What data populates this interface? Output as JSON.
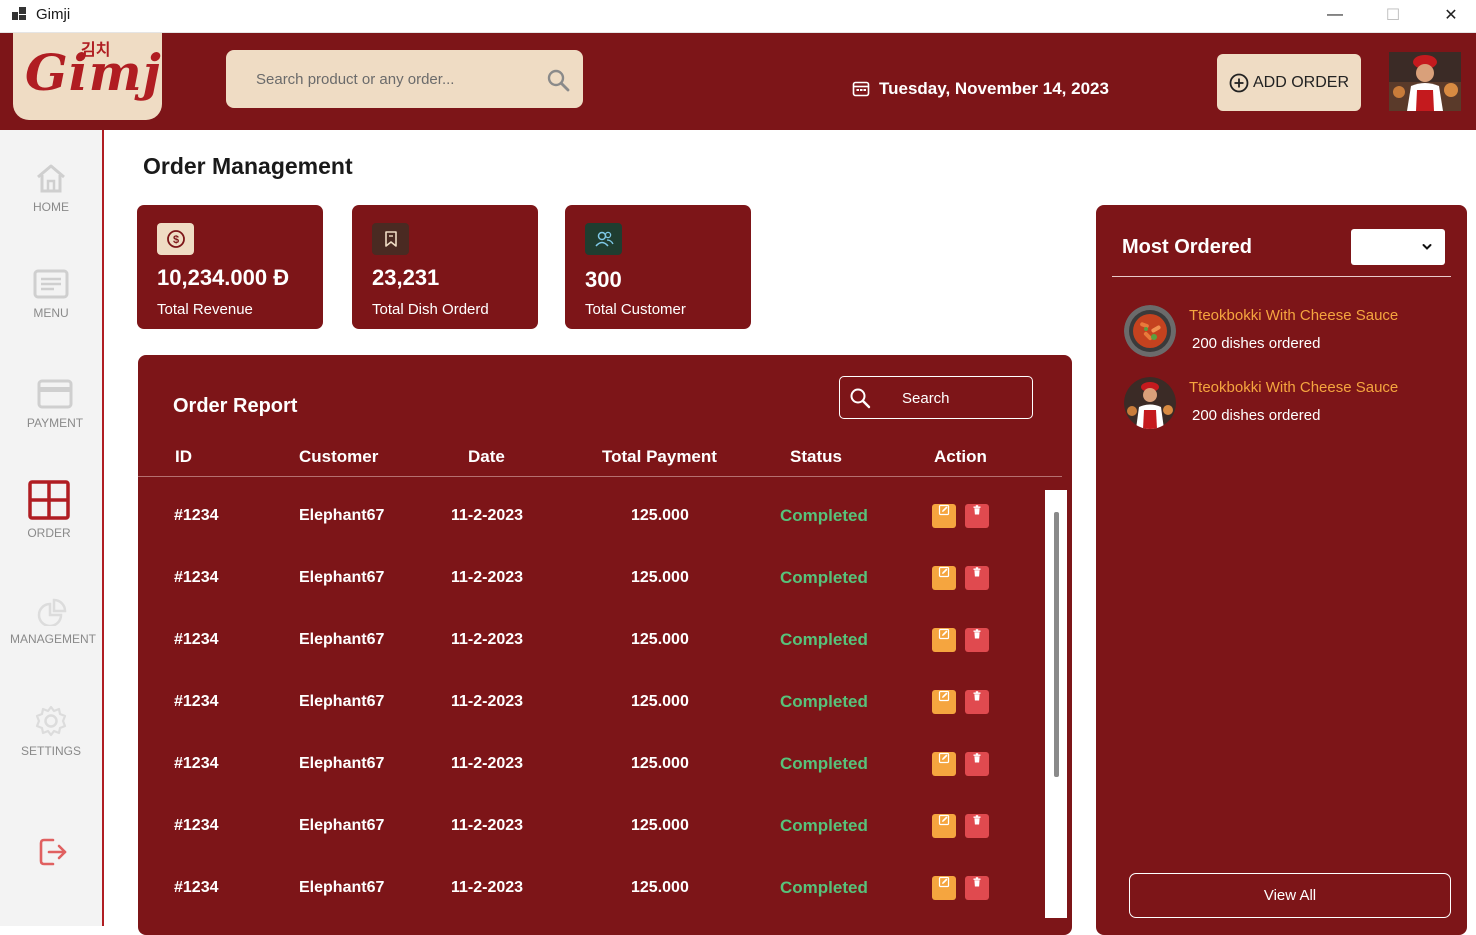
{
  "window": {
    "title": "Gimji",
    "minimize": "—",
    "maximize": "☐",
    "close": "✕"
  },
  "header": {
    "logo_text": "Gimji",
    "logo_korean": "김치",
    "search_placeholder": "Search product or any order...",
    "date": "Tuesday, November 14, 2023",
    "add_order_label": "ADD ORDER"
  },
  "sidebar": {
    "items": [
      {
        "label": "HOME",
        "icon": "home-icon"
      },
      {
        "label": "MENU",
        "icon": "menu-icon"
      },
      {
        "label": "PAYMENT",
        "icon": "payment-icon"
      },
      {
        "label": "ORDER",
        "icon": "order-icon"
      },
      {
        "label": "MANAGEMENT",
        "icon": "management-icon"
      },
      {
        "label": "SETTINGS",
        "icon": "settings-icon"
      }
    ],
    "active": "ORDER",
    "logout_icon": "logout-icon"
  },
  "page": {
    "title": "Order Management"
  },
  "stats": [
    {
      "value": "10,234.000 Đ",
      "label": "Total Revenue",
      "icon": "coin-icon",
      "icon_bg": "#efdcc4"
    },
    {
      "value": "23,231",
      "label": "Total Dish Orderd",
      "icon": "bookmark-icon",
      "icon_bg": "#4a2a22"
    },
    {
      "value": "300",
      "label": "Total Customer",
      "icon": "users-icon",
      "icon_bg": "#1f3d30"
    }
  ],
  "report": {
    "title": "Order Report",
    "search_label": "Search",
    "columns": [
      "ID",
      "Customer",
      "Date",
      "Total Payment",
      "Status",
      "Action"
    ],
    "rows": [
      {
        "id": "#1234",
        "customer": "Elephant67",
        "date": "11-2-2023",
        "total": "125.000",
        "status": "Completed"
      },
      {
        "id": "#1234",
        "customer": "Elephant67",
        "date": "11-2-2023",
        "total": "125.000",
        "status": "Completed"
      },
      {
        "id": "#1234",
        "customer": "Elephant67",
        "date": "11-2-2023",
        "total": "125.000",
        "status": "Completed"
      },
      {
        "id": "#1234",
        "customer": "Elephant67",
        "date": "11-2-2023",
        "total": "125.000",
        "status": "Completed"
      },
      {
        "id": "#1234",
        "customer": "Elephant67",
        "date": "11-2-2023",
        "total": "125.000",
        "status": "Completed"
      },
      {
        "id": "#1234",
        "customer": "Elephant67",
        "date": "11-2-2023",
        "total": "125.000",
        "status": "Completed"
      },
      {
        "id": "#1234",
        "customer": "Elephant67",
        "date": "11-2-2023",
        "total": "125.000",
        "status": "Completed"
      }
    ]
  },
  "most_ordered": {
    "title": "Most Ordered",
    "period_value": "",
    "items": [
      {
        "name": "Tteokbokki With Cheese Sauce",
        "count": "200 dishes ordered",
        "image": "dish-photo"
      },
      {
        "name": "Tteokbokki With Cheese Sauce",
        "count": "200 dishes ordered",
        "image": "chef-photo"
      }
    ],
    "view_all_label": "View All"
  },
  "colors": {
    "brand": "#7d1518",
    "cream": "#efdcc4",
    "status_completed": "#57c27a",
    "edit_button": "#f5a53f",
    "delete_button": "#e04a4f"
  }
}
